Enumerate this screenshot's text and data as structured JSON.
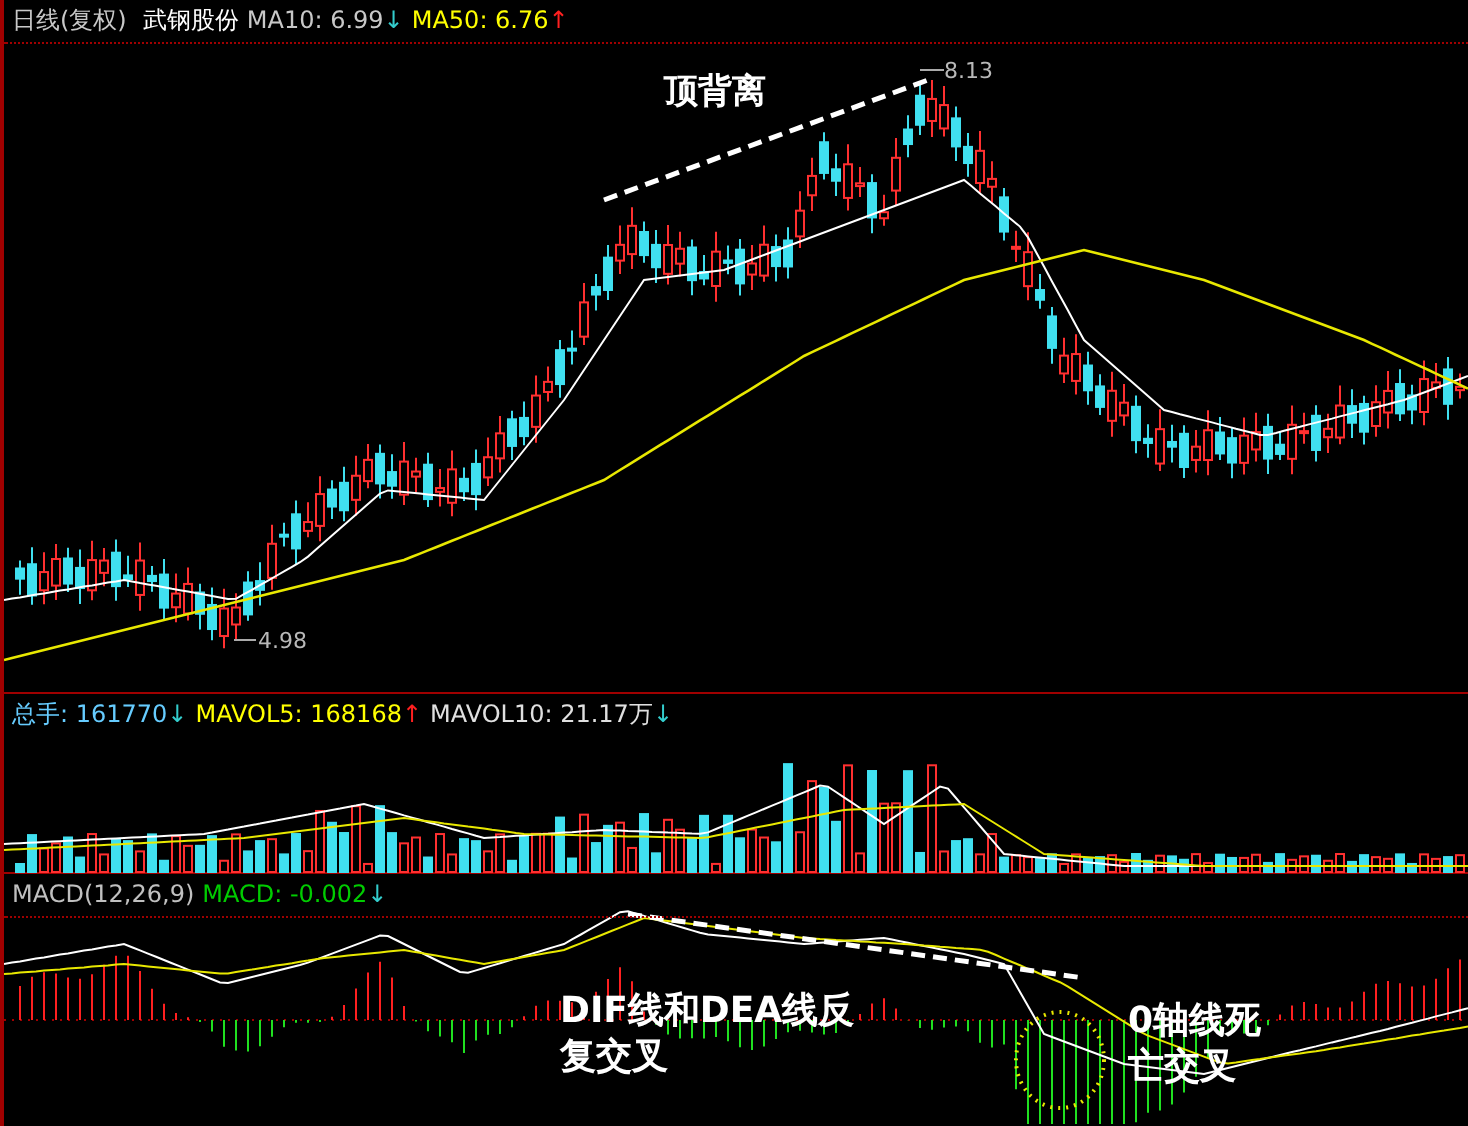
{
  "price_panel": {
    "period": "日线(复权)",
    "stock": "武钢股份",
    "indicators": [
      {
        "label": "MA10: 6.99",
        "trend": "↓"
      },
      {
        "label": "MA50: 6.76",
        "trend": "↑"
      }
    ],
    "annotation": "顶背离",
    "high_label": "8.13",
    "low_label": "4.98"
  },
  "volume_panel": {
    "indicators": [
      {
        "label": "总手: 161770",
        "trend": "↓"
      },
      {
        "label": "MAVOL5: 168168",
        "trend": "↑"
      },
      {
        "label": "MAVOL10: 21.17万",
        "trend": "↓"
      }
    ]
  },
  "macd_panel": {
    "indicators": [
      {
        "label": "MACD(12,26,9)"
      },
      {
        "label": "MACD: -0.002",
        "trend": "↓"
      }
    ],
    "annotations": [
      "DIF线和DEA线反复交叉",
      "0轴线死亡交叉"
    ]
  }
}
